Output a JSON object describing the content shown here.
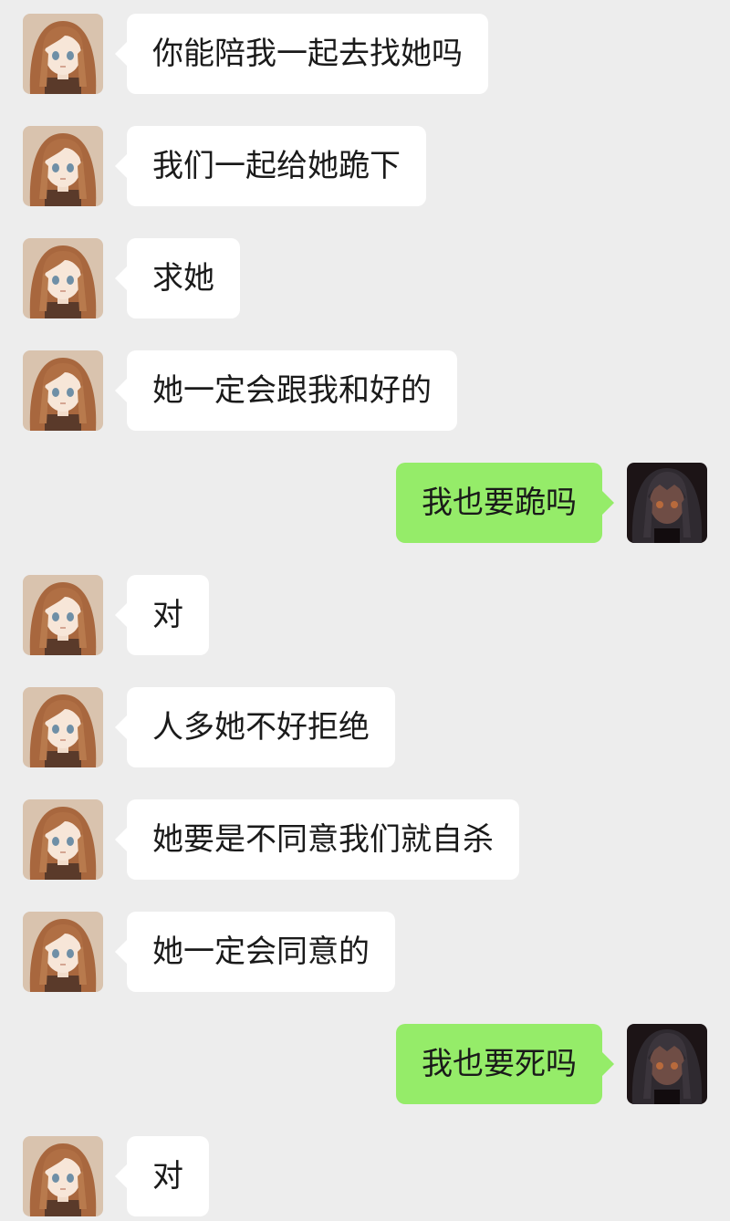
{
  "colors": {
    "background": "#ededed",
    "incoming_bubble": "#ffffff",
    "outgoing_bubble": "#95ec69",
    "text": "#1a1a1a"
  },
  "contacts": {
    "other": {
      "avatar_icon": "anime-girl-brown-hair-avatar-icon"
    },
    "me": {
      "avatar_icon": "anime-girl-dark-hair-avatar-icon"
    }
  },
  "messages": [
    {
      "sender": "other",
      "text": "你能陪我一起去找她吗"
    },
    {
      "sender": "other",
      "text": "我们一起给她跪下"
    },
    {
      "sender": "other",
      "text": "求她"
    },
    {
      "sender": "other",
      "text": "她一定会跟我和好的"
    },
    {
      "sender": "me",
      "text": "我也要跪吗"
    },
    {
      "sender": "other",
      "text": "对"
    },
    {
      "sender": "other",
      "text": "人多她不好拒绝"
    },
    {
      "sender": "other",
      "text": "她要是不同意我们就自杀"
    },
    {
      "sender": "other",
      "text": "她一定会同意的"
    },
    {
      "sender": "me",
      "text": "我也要死吗"
    },
    {
      "sender": "other",
      "text": "对"
    }
  ]
}
